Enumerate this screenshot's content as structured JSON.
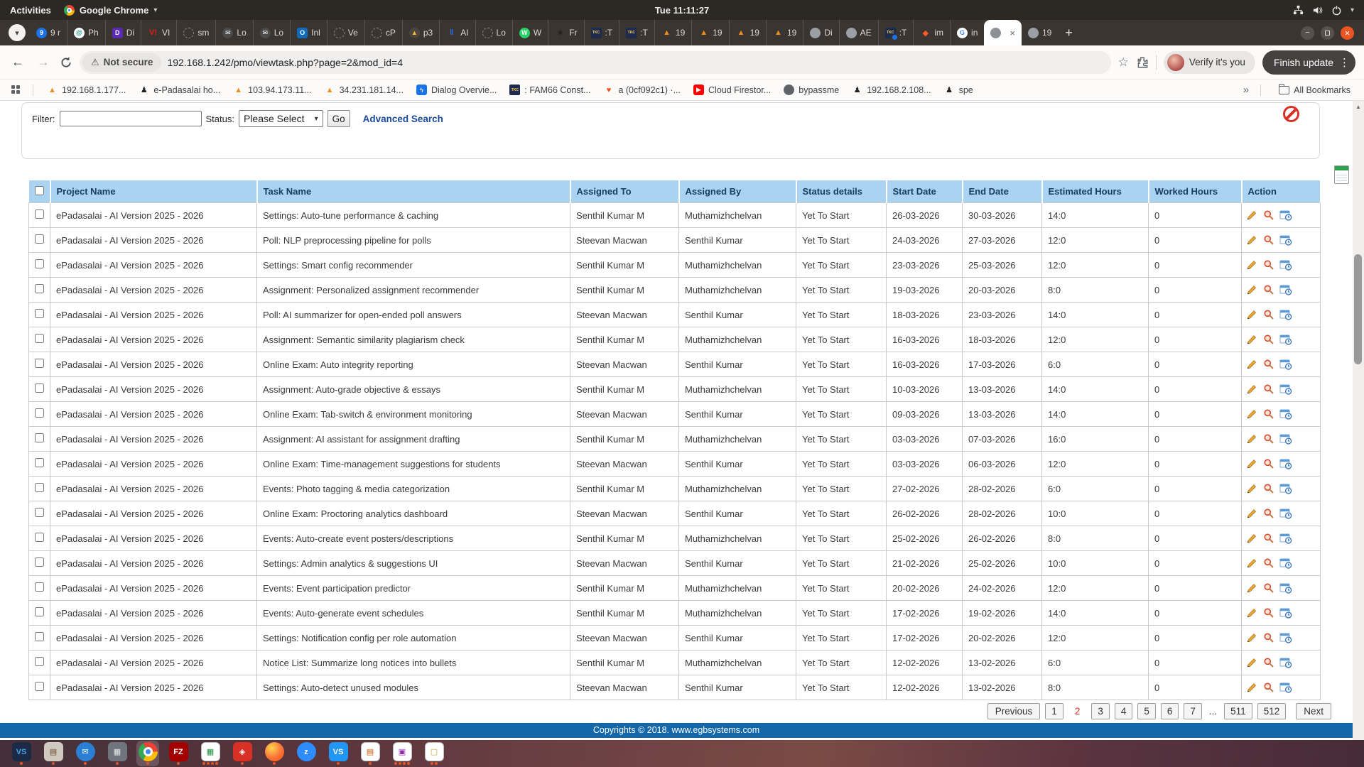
{
  "colors": {
    "table_header_bg": "#a9d3f1",
    "table_header_text": "#1a3c63",
    "footer_bg": "#1467a8",
    "link": "#1b4a9b",
    "page_current": "#e02b20",
    "prohibit": "#d93025",
    "dock_dot": "#e95420"
  },
  "icons": {
    "warning": "⚠",
    "star": "☆",
    "kebab": "⋮",
    "overflow": "»",
    "caret": "▾",
    "back": "←",
    "forward": "→",
    "reload": "⟳",
    "scroll_up": "▲"
  },
  "ubuntu_bar": {
    "activities": "Activities",
    "app_name": "Google Chrome",
    "clock": "Tue 11:11:27"
  },
  "tabstrip": {
    "new_tab": "+",
    "tabs": [
      {
        "label": "9 r",
        "icon": "9",
        "bg": "#1a73e8",
        "fg": "#ffffff",
        "shape": "c"
      },
      {
        "label": "Ph",
        "icon": "@",
        "bg": "#ffffff",
        "fg": "#0d9488",
        "shape": "c"
      },
      {
        "label": "Di",
        "icon": "D",
        "bg": "#5b2ab5",
        "fg": "#ffffff",
        "shape": "s"
      },
      {
        "label": "VI",
        "icon": "V!",
        "fg": "#e01e1e",
        "shape": "n"
      },
      {
        "label": "sm",
        "icon": "",
        "shape": "d"
      },
      {
        "label": "Lo",
        "icon": "✉",
        "bg": "#4a4a4a",
        "fg": "#ffffff",
        "shape": "c"
      },
      {
        "label": "Lo",
        "icon": "✉",
        "bg": "#4a4a4a",
        "fg": "#ffffff",
        "shape": "c"
      },
      {
        "label": "Inl",
        "icon": "O",
        "bg": "#0f6cbd",
        "fg": "#ffffff",
        "shape": "s"
      },
      {
        "label": "Ve",
        "icon": "",
        "shape": "d"
      },
      {
        "label": "cP",
        "icon": "",
        "shape": "d"
      },
      {
        "label": "p3",
        "icon": "▲",
        "bg": "#4b4540",
        "fg": "#fbbf24",
        "shape": "c"
      },
      {
        "label": "AI",
        "icon": "‖",
        "fg": "#2f6fe4",
        "shape": "n"
      },
      {
        "label": "Lo",
        "icon": "",
        "shape": "d"
      },
      {
        "label": "W",
        "icon": "W",
        "bg": "#25d366",
        "fg": "#ffffff",
        "shape": "c"
      },
      {
        "label": "Fr",
        "icon": "✳",
        "fg": "#161616",
        "shape": "n"
      },
      {
        "label": ":T",
        "icon": "TKC",
        "bg": "#1d2b4f",
        "fg": "#ffd34d",
        "shape": "tkc"
      },
      {
        "label": ":T",
        "icon": "TKC",
        "bg": "#1d2b4f",
        "fg": "#ffd34d",
        "shape": "tkc"
      },
      {
        "label": "19",
        "icon": "▲",
        "fg": "#f08c1a",
        "shape": "n"
      },
      {
        "label": "19",
        "icon": "▲",
        "fg": "#f08c1a",
        "shape": "n"
      },
      {
        "label": "19",
        "icon": "▲",
        "fg": "#f08c1a",
        "shape": "n"
      },
      {
        "label": "19",
        "icon": "▲",
        "fg": "#f08c1a",
        "shape": "n"
      },
      {
        "label": "Di",
        "icon": "",
        "bg": "#9aa0a6",
        "shape": "c"
      },
      {
        "label": "AE",
        "icon": "",
        "bg": "#9aa0a6",
        "shape": "c"
      },
      {
        "label": ":T",
        "icon": "TKC",
        "bg": "#1d2b4f",
        "fg": "#ffd34d",
        "shape": "tkc",
        "dot": true
      },
      {
        "label": "im",
        "icon": "◆",
        "fg": "#ff5a2a",
        "shape": "n"
      },
      {
        "label": "in",
        "icon": "G",
        "bg": "#ffffff",
        "fg": "#4285f4",
        "shape": "c"
      },
      {
        "label": "",
        "icon": "",
        "bg": "#8d9196",
        "shape": "c",
        "active": true
      },
      {
        "label": "19",
        "icon": "",
        "bg": "#9aa0a6",
        "shape": "c"
      }
    ],
    "close_glyph": "×",
    "minimize_glyph": "−",
    "close_window_glyph": "×",
    "tab_search_glyph": "▾"
  },
  "toolbar": {
    "not_secure": "Not secure",
    "url": "192.168.1.242/pmo/viewtask.php?page=2&mod_id=4",
    "verify_chip": "Verify it's you",
    "finish_update": "Finish update"
  },
  "bookmarks": {
    "items": [
      {
        "label": "192.168.1.177...",
        "icon": "▲",
        "fg": "#f08c1a",
        "shape": "n"
      },
      {
        "label": "e-Padasalai ho...",
        "icon": "♟",
        "fg": "#222222",
        "shape": "n"
      },
      {
        "label": "103.94.173.11...",
        "icon": "▲",
        "fg": "#f08c1a",
        "shape": "n"
      },
      {
        "label": "34.231.181.14...",
        "icon": "▲",
        "fg": "#f08c1a",
        "shape": "n"
      },
      {
        "label": "Dialog Overvie...",
        "icon": "ϟ",
        "bg": "#1a73e8",
        "fg": "#ffffff",
        "shape": "s"
      },
      {
        "label": ": FAM66 Const...",
        "icon": "TKC",
        "bg": "#1d2b4f",
        "fg": "#ffd34d",
        "shape": "tkc"
      },
      {
        "label": "a (0cf092c1) ·...",
        "icon": "♥",
        "fg": "#f4511e",
        "shape": "n"
      },
      {
        "label": "Cloud Firestor...",
        "icon": "▶",
        "bg": "#ff0000",
        "fg": "#ffffff",
        "shape": "s"
      },
      {
        "label": "bypassme",
        "icon": "",
        "bg": "#5f6368",
        "shape": "c"
      },
      {
        "label": "192.168.2.108...",
        "icon": "♟",
        "fg": "#222222",
        "shape": "n"
      },
      {
        "label": "spe",
        "icon": "♟",
        "fg": "#222222",
        "shape": "n"
      }
    ],
    "overflow": "»",
    "all_bookmarks": "All Bookmarks"
  },
  "filter_panel": {
    "filter_label": "Filter:",
    "filter_value": "",
    "status_label": "Status:",
    "status_value": "Please Select",
    "go": "Go",
    "advanced_search": "Advanced Search"
  },
  "table": {
    "headers": [
      {
        "label": "Project Name"
      },
      {
        "label": "Task Name"
      },
      {
        "label": "Assigned To"
      },
      {
        "label": "Assigned By"
      },
      {
        "label": "Status details"
      },
      {
        "label": "Start Date"
      },
      {
        "label": "End Date"
      },
      {
        "label": "Estimated Hours"
      },
      {
        "label": "Worked Hours"
      },
      {
        "label": "Action"
      }
    ],
    "rows": [
      {
        "project": "ePadasalai - AI Version 2025 - 2026",
        "task": "Settings: Auto-tune performance & caching",
        "assigned_to": "Senthil Kumar M",
        "assigned_by": "Muthamizhchelvan",
        "status": "Yet To Start",
        "start_date": "26-03-2026",
        "end_date": "30-03-2026",
        "est_hours": "14:0",
        "worked_hours": "0"
      },
      {
        "project": "ePadasalai - AI Version 2025 - 2026",
        "task": "Poll: NLP preprocessing pipeline for polls",
        "assigned_to": "Steevan Macwan",
        "assigned_by": "Senthil Kumar",
        "status": "Yet To Start",
        "start_date": "24-03-2026",
        "end_date": "27-03-2026",
        "est_hours": "12:0",
        "worked_hours": "0"
      },
      {
        "project": "ePadasalai - AI Version 2025 - 2026",
        "task": "Settings: Smart config recommender",
        "assigned_to": "Senthil Kumar M",
        "assigned_by": "Muthamizhchelvan",
        "status": "Yet To Start",
        "start_date": "23-03-2026",
        "end_date": "25-03-2026",
        "est_hours": "12:0",
        "worked_hours": "0"
      },
      {
        "project": "ePadasalai - AI Version 2025 - 2026",
        "task": "Assignment: Personalized assignment recommender",
        "assigned_to": "Senthil Kumar M",
        "assigned_by": "Muthamizhchelvan",
        "status": "Yet To Start",
        "start_date": "19-03-2026",
        "end_date": "20-03-2026",
        "est_hours": "8:0",
        "worked_hours": "0"
      },
      {
        "project": "ePadasalai - AI Version 2025 - 2026",
        "task": "Poll: AI summarizer for open-ended poll answers",
        "assigned_to": "Steevan Macwan",
        "assigned_by": "Senthil Kumar",
        "status": "Yet To Start",
        "start_date": "18-03-2026",
        "end_date": "23-03-2026",
        "est_hours": "14:0",
        "worked_hours": "0"
      },
      {
        "project": "ePadasalai - AI Version 2025 - 2026",
        "task": "Assignment: Semantic similarity plagiarism check",
        "assigned_to": "Senthil Kumar M",
        "assigned_by": "Muthamizhchelvan",
        "status": "Yet To Start",
        "start_date": "16-03-2026",
        "end_date": "18-03-2026",
        "est_hours": "12:0",
        "worked_hours": "0"
      },
      {
        "project": "ePadasalai - AI Version 2025 - 2026",
        "task": "Online Exam: Auto integrity reporting",
        "assigned_to": "Steevan Macwan",
        "assigned_by": "Senthil Kumar",
        "status": "Yet To Start",
        "start_date": "16-03-2026",
        "end_date": "17-03-2026",
        "est_hours": "6:0",
        "worked_hours": "0"
      },
      {
        "project": "ePadasalai - AI Version 2025 - 2026",
        "task": "Assignment: Auto-grade objective & essays",
        "assigned_to": "Senthil Kumar M",
        "assigned_by": "Muthamizhchelvan",
        "status": "Yet To Start",
        "start_date": "10-03-2026",
        "end_date": "13-03-2026",
        "est_hours": "14:0",
        "worked_hours": "0"
      },
      {
        "project": "ePadasalai - AI Version 2025 - 2026",
        "task": "Online Exam: Tab-switch & environment monitoring",
        "assigned_to": "Steevan Macwan",
        "assigned_by": "Senthil Kumar",
        "status": "Yet To Start",
        "start_date": "09-03-2026",
        "end_date": "13-03-2026",
        "est_hours": "14:0",
        "worked_hours": "0"
      },
      {
        "project": "ePadasalai - AI Version 2025 - 2026",
        "task": "Assignment: AI assistant for assignment drafting",
        "assigned_to": "Senthil Kumar M",
        "assigned_by": "Muthamizhchelvan",
        "status": "Yet To Start",
        "start_date": "03-03-2026",
        "end_date": "07-03-2026",
        "est_hours": "16:0",
        "worked_hours": "0"
      },
      {
        "project": "ePadasalai - AI Version 2025 - 2026",
        "task": "Online Exam: Time-management suggestions for students",
        "assigned_to": "Steevan Macwan",
        "assigned_by": "Senthil Kumar",
        "status": "Yet To Start",
        "start_date": "03-03-2026",
        "end_date": "06-03-2026",
        "est_hours": "12:0",
        "worked_hours": "0"
      },
      {
        "project": "ePadasalai - AI Version 2025 - 2026",
        "task": "Events: Photo tagging & media categorization",
        "assigned_to": "Senthil Kumar M",
        "assigned_by": "Muthamizhchelvan",
        "status": "Yet To Start",
        "start_date": "27-02-2026",
        "end_date": "28-02-2026",
        "est_hours": "6:0",
        "worked_hours": "0"
      },
      {
        "project": "ePadasalai - AI Version 2025 - 2026",
        "task": "Online Exam: Proctoring analytics dashboard",
        "assigned_to": "Steevan Macwan",
        "assigned_by": "Senthil Kumar",
        "status": "Yet To Start",
        "start_date": "26-02-2026",
        "end_date": "28-02-2026",
        "est_hours": "10:0",
        "worked_hours": "0"
      },
      {
        "project": "ePadasalai - AI Version 2025 - 2026",
        "task": "Events: Auto-create event posters/descriptions",
        "assigned_to": "Senthil Kumar M",
        "assigned_by": "Muthamizhchelvan",
        "status": "Yet To Start",
        "start_date": "25-02-2026",
        "end_date": "26-02-2026",
        "est_hours": "8:0",
        "worked_hours": "0"
      },
      {
        "project": "ePadasalai - AI Version 2025 - 2026",
        "task": "Settings: Admin analytics & suggestions UI",
        "assigned_to": "Steevan Macwan",
        "assigned_by": "Senthil Kumar",
        "status": "Yet To Start",
        "start_date": "21-02-2026",
        "end_date": "25-02-2026",
        "est_hours": "10:0",
        "worked_hours": "0"
      },
      {
        "project": "ePadasalai - AI Version 2025 - 2026",
        "task": "Events: Event participation predictor",
        "assigned_to": "Senthil Kumar M",
        "assigned_by": "Muthamizhchelvan",
        "status": "Yet To Start",
        "start_date": "20-02-2026",
        "end_date": "24-02-2026",
        "est_hours": "12:0",
        "worked_hours": "0"
      },
      {
        "project": "ePadasalai - AI Version 2025 - 2026",
        "task": "Events: Auto-generate event schedules",
        "assigned_to": "Senthil Kumar M",
        "assigned_by": "Muthamizhchelvan",
        "status": "Yet To Start",
        "start_date": "17-02-2026",
        "end_date": "19-02-2026",
        "est_hours": "14:0",
        "worked_hours": "0"
      },
      {
        "project": "ePadasalai - AI Version 2025 - 2026",
        "task": "Settings: Notification config per role automation",
        "assigned_to": "Steevan Macwan",
        "assigned_by": "Senthil Kumar",
        "status": "Yet To Start",
        "start_date": "17-02-2026",
        "end_date": "20-02-2026",
        "est_hours": "12:0",
        "worked_hours": "0"
      },
      {
        "project": "ePadasalai - AI Version 2025 - 2026",
        "task": "Notice List: Summarize long notices into bullets",
        "assigned_to": "Senthil Kumar M",
        "assigned_by": "Muthamizhchelvan",
        "status": "Yet To Start",
        "start_date": "12-02-2026",
        "end_date": "13-02-2026",
        "est_hours": "6:0",
        "worked_hours": "0"
      },
      {
        "project": "ePadasalai - AI Version 2025 - 2026",
        "task": "Settings: Auto-detect unused modules",
        "assigned_to": "Steevan Macwan",
        "assigned_by": "Senthil Kumar",
        "status": "Yet To Start",
        "start_date": "12-02-2026",
        "end_date": "13-02-2026",
        "est_hours": "8:0",
        "worked_hours": "0"
      }
    ]
  },
  "pagination": {
    "previous": "Previous",
    "next": "Next",
    "pages": [
      {
        "label": "1"
      },
      {
        "label": "2",
        "current": true
      },
      {
        "label": "3"
      },
      {
        "label": "4"
      },
      {
        "label": "5"
      },
      {
        "label": "6"
      },
      {
        "label": "7"
      },
      {
        "label": "...",
        "plain": true
      },
      {
        "label": "511"
      },
      {
        "label": "512"
      }
    ]
  },
  "footer": {
    "copyright": "Copyrights © 2018. www.egbsystems.com"
  },
  "dock": {
    "items": [
      {
        "name": "code-insiders",
        "glyph": "VS",
        "bg": "#1b2a47",
        "fg": "#4aa3e8",
        "shape": "s",
        "dots": 1
      },
      {
        "name": "file-cabinet",
        "glyph": "▤",
        "bg": "#cfc9c0",
        "fg": "#6b4b2a",
        "shape": "s",
        "dots": 1
      },
      {
        "name": "thunderbird",
        "glyph": "✉",
        "bg": "#2a7fd4",
        "fg": "#ffffff",
        "shape": "c",
        "dots": 1
      },
      {
        "name": "calculator",
        "glyph": "▦",
        "bg": "#70757d",
        "fg": "#e7e7e7",
        "shape": "s",
        "dots": 1
      },
      {
        "name": "chrome",
        "glyph": "",
        "shape": "chrome",
        "dots": 1,
        "active": true
      },
      {
        "name": "filezilla",
        "glyph": "FZ",
        "bg": "#a40000",
        "fg": "#ffffff",
        "shape": "s",
        "dots": 1
      },
      {
        "name": "libreoffice-calc",
        "glyph": "▦",
        "bg": "#ffffff",
        "fg": "#1e8e3e",
        "shape": "s lo",
        "dots": 4
      },
      {
        "name": "red-app",
        "glyph": "◈",
        "bg": "#d93025",
        "fg": "#ffffff",
        "shape": "s",
        "dots": 1
      },
      {
        "name": "firefox",
        "glyph": "",
        "shape": "ffx",
        "dots": 1
      },
      {
        "name": "zoom",
        "glyph": "z",
        "bg": "#2d8cff",
        "fg": "#ffffff",
        "shape": "c",
        "dots": 0
      },
      {
        "name": "vscode",
        "glyph": "VS",
        "bg": "#2196f3",
        "fg": "#ffffff",
        "shape": "s",
        "dots": 1
      },
      {
        "name": "libreoffice-impress",
        "glyph": "▤",
        "bg": "#ffffff",
        "fg": "#d35400",
        "shape": "s lo",
        "dots": 1
      },
      {
        "name": "libreoffice-draw",
        "glyph": "▣",
        "bg": "#ffffff",
        "fg": "#8e24aa",
        "shape": "s lo",
        "dots": 4
      },
      {
        "name": "libreoffice-writer",
        "glyph": "▢",
        "bg": "#ffffff",
        "fg": "#c9a227",
        "shape": "s lo",
        "dots": 2
      }
    ]
  }
}
